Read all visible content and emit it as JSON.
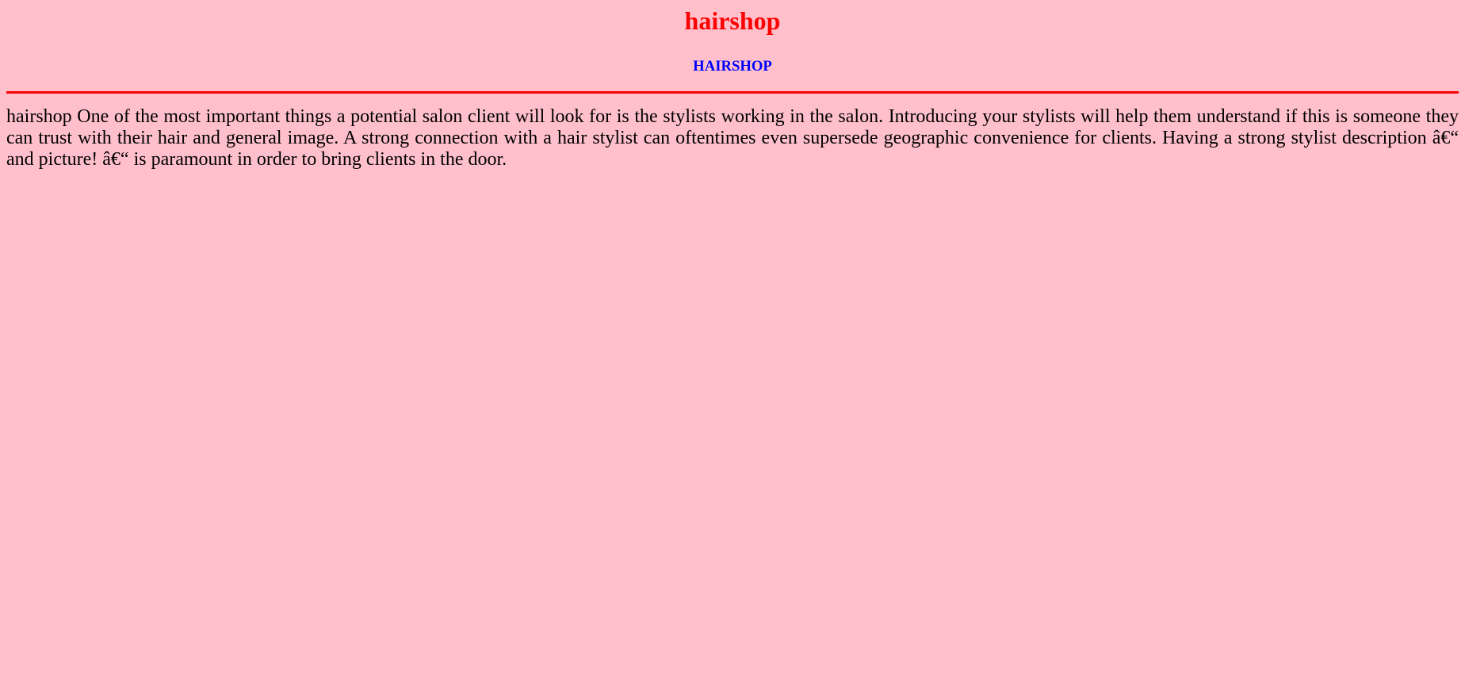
{
  "header": {
    "title": "hairshop",
    "subtitle": "HAIRSHOP"
  },
  "content": {
    "paragraph": "hairshop One of the most important things a potential salon client will look for is the stylists working in the salon. Introducing your stylists will help them understand if this is someone they can trust with their hair and general image. A strong connection with a hair stylist can oftentimes even supersede geographic convenience for clients. Having a strong stylist description â€“ and picture! â€“ is paramount in order to bring clients in the door."
  },
  "colors": {
    "background": "#ffc0cb",
    "title": "#ff0000",
    "subtitle": "#0000ff",
    "divider": "#ff0000",
    "text": "#000000"
  }
}
